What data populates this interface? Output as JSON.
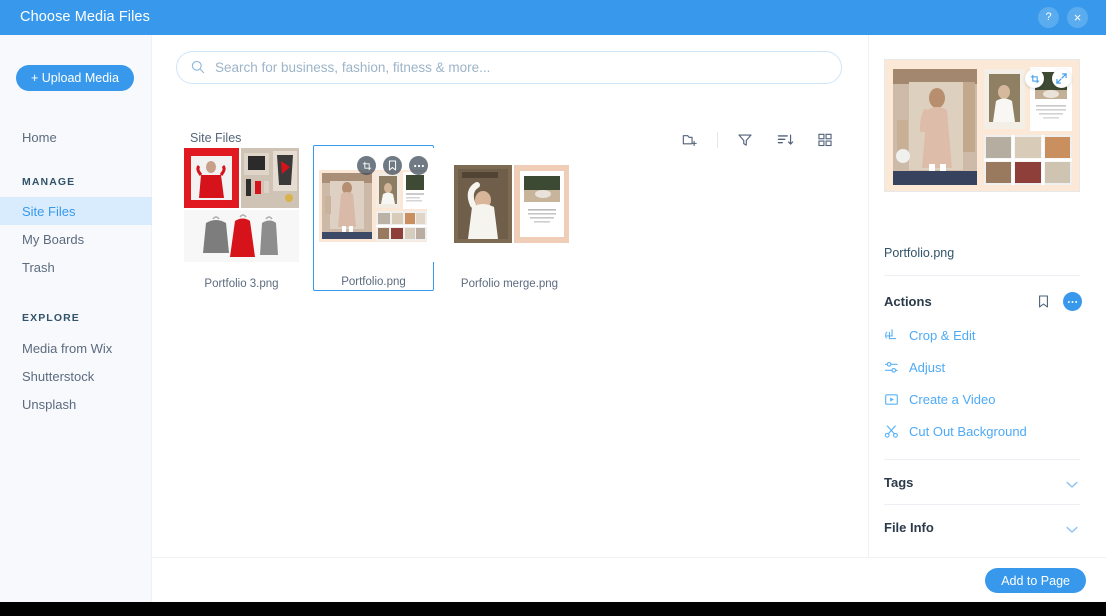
{
  "window": {
    "title": "Choose Media Files",
    "help_label": "?",
    "close_label": "×"
  },
  "sidebar": {
    "upload_button": "+ Upload Media",
    "home": "Home",
    "group_manage": "MANAGE",
    "group_explore": "EXPLORE",
    "manage_items": [
      "Site Files",
      "My Boards",
      "Trash"
    ],
    "explore_items": [
      "Media from Wix",
      "Shutterstock",
      "Unsplash"
    ],
    "active_item": "Site Files"
  },
  "search": {
    "placeholder": "Search for business, fashion, fitness & more...",
    "value": ""
  },
  "toolbar": {
    "breadcrumb": "Site Files",
    "icons": [
      "new-folder-icon",
      "filter-icon",
      "sort-icon",
      "grid-view-icon"
    ]
  },
  "files": [
    {
      "name": "Portfolio 3.png",
      "selected": false
    },
    {
      "name": "Portfolio.png",
      "selected": true
    },
    {
      "name": "Porfolio merge.png",
      "selected": false
    }
  ],
  "thumb_actions": [
    "crop-icon",
    "bookmark-icon",
    "more-icon"
  ],
  "preview": {
    "actions": [
      "crop-icon",
      "expand-icon"
    ],
    "filename": "Portfolio.png"
  },
  "details": {
    "actions_title": "Actions",
    "actions": [
      {
        "label": "Crop & Edit",
        "icon": "crop-rotate-icon"
      },
      {
        "label": "Adjust",
        "icon": "sliders-icon"
      },
      {
        "label": "Create a Video",
        "icon": "video-icon"
      },
      {
        "label": "Cut Out Background",
        "icon": "scissors-icon"
      }
    ],
    "tags_title": "Tags",
    "fileinfo_title": "File Info"
  },
  "footer": {
    "add_button": "Add to Page"
  },
  "colors": {
    "brand_blue": "#3899ec",
    "link_blue": "#4eaaf5",
    "sidebar_bg": "#f7f9fc",
    "active_bg": "#d9ecfd"
  }
}
